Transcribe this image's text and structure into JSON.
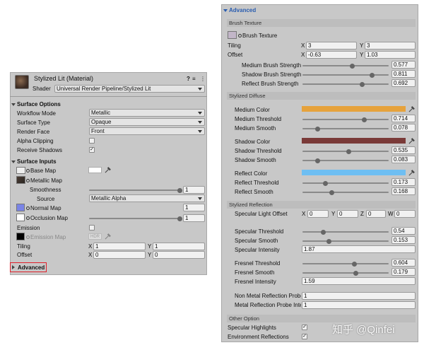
{
  "left": {
    "title": "Stylized Lit (Material)",
    "header_icons": [
      "?",
      "≡",
      "⋮"
    ],
    "shader_label": "Shader",
    "shader_value": "Universal Render Pipeline/Stylized Lit",
    "surface_options": {
      "title": "Surface Options",
      "rows": [
        {
          "label": "Workflow Mode",
          "value": "Metallic"
        },
        {
          "label": "Surface Type",
          "value": "Opaque"
        },
        {
          "label": "Render Face",
          "value": "Front"
        }
      ],
      "alpha_clipping": "Alpha Clipping",
      "receive_shadows": "Receive Shadows",
      "check_mark": "✓"
    },
    "surface_inputs": {
      "title": "Surface Inputs",
      "base_map": "Base Map",
      "metallic_map": "Metallic Map",
      "smoothness": "Smoothness",
      "smoothness_value": "1",
      "source_label": "Source",
      "source_value": "Metallic Alpha",
      "normal_map": "Normal Map",
      "normal_value": "1",
      "occlusion_map": "Occlusion Map",
      "occlusion_value": "1",
      "emission": "Emission",
      "emission_map": "Emission Map",
      "hdr": "HDR",
      "tiling": "Tiling",
      "tiling_x": "1",
      "tiling_y": "1",
      "offset": "Offset",
      "offset_x": "0",
      "offset_y": "0",
      "x": "X",
      "y": "Y"
    },
    "advanced": "Advanced"
  },
  "right": {
    "title": "Advanced",
    "brush_texture_hdr": "Brush Texture",
    "brush_texture": "Brush Texture",
    "tiling": "Tiling",
    "tiling_x": "3",
    "tiling_y": "3",
    "offset": "Offset",
    "offset_x": "-0.63",
    "offset_y": "1.03",
    "x": "X",
    "y": "Y",
    "z": "Z",
    "w": "W",
    "brush_sliders": [
      {
        "label": "Medium Brush Strength",
        "value": "0.577",
        "fraction": 0.577
      },
      {
        "label": "Shadow Brush Strength",
        "value": "0.811",
        "fraction": 0.811
      },
      {
        "label": "Reflect Brush Strength",
        "value": "0.692",
        "fraction": 0.692
      }
    ],
    "diffuse_hdr": "Stylized Diffuse",
    "medium_color": "Medium Color",
    "medium_color_hex": "#E6A23C",
    "medium_threshold": "Medium Threshold",
    "medium_threshold_value": "0.714",
    "medium_smooth": "Medium Smooth",
    "medium_smooth_value": "0.078",
    "shadow_color": "Shadow Color",
    "shadow_color_hex": "#7A3A38",
    "shadow_threshold": "Shadow Threshold",
    "shadow_threshold_value": "0.535",
    "shadow_smooth": "Shadow Smooth",
    "shadow_smooth_value": "0.083",
    "reflect_color": "Reflect Color",
    "reflect_color_hex": "#6EBEF2",
    "reflect_threshold": "Reflect Threshold",
    "reflect_threshold_value": "0.173",
    "reflect_smooth": "Reflect Smooth",
    "reflect_smooth_value": "0.168",
    "reflection_hdr": "Stylized Reflection",
    "spec_light_offset": "Specular Light Offset",
    "spec_x": "0",
    "spec_y": "0",
    "spec_z": "0",
    "spec_w": "0",
    "spec_threshold": "Specular Threshold",
    "spec_threshold_value": "0.54",
    "spec_smooth": "Specular Smooth",
    "spec_smooth_value": "0.153",
    "spec_intensity": "Specular Intensity",
    "spec_intensity_value": "1.87",
    "fresnel_threshold": "Fresnel Threshold",
    "fresnel_threshold_value": "0.604",
    "fresnel_smooth": "Fresnel Smooth",
    "fresnel_smooth_value": "0.179",
    "fresnel_intensity": "Fresnel Intensity",
    "fresnel_intensity_value": "1.59",
    "non_metal_probe": "Non Metal Reflection Probe Intensity",
    "non_metal_probe_value": "1",
    "metal_probe": "Metal Reflection Probe Intensity",
    "metal_probe_value": "1",
    "other_hdr": "Other Option",
    "spec_highlights": "Specular Highlights",
    "env_reflections": "Environment Reflections",
    "check_mark": "✓"
  },
  "watermark": "知乎 @Qinfei"
}
